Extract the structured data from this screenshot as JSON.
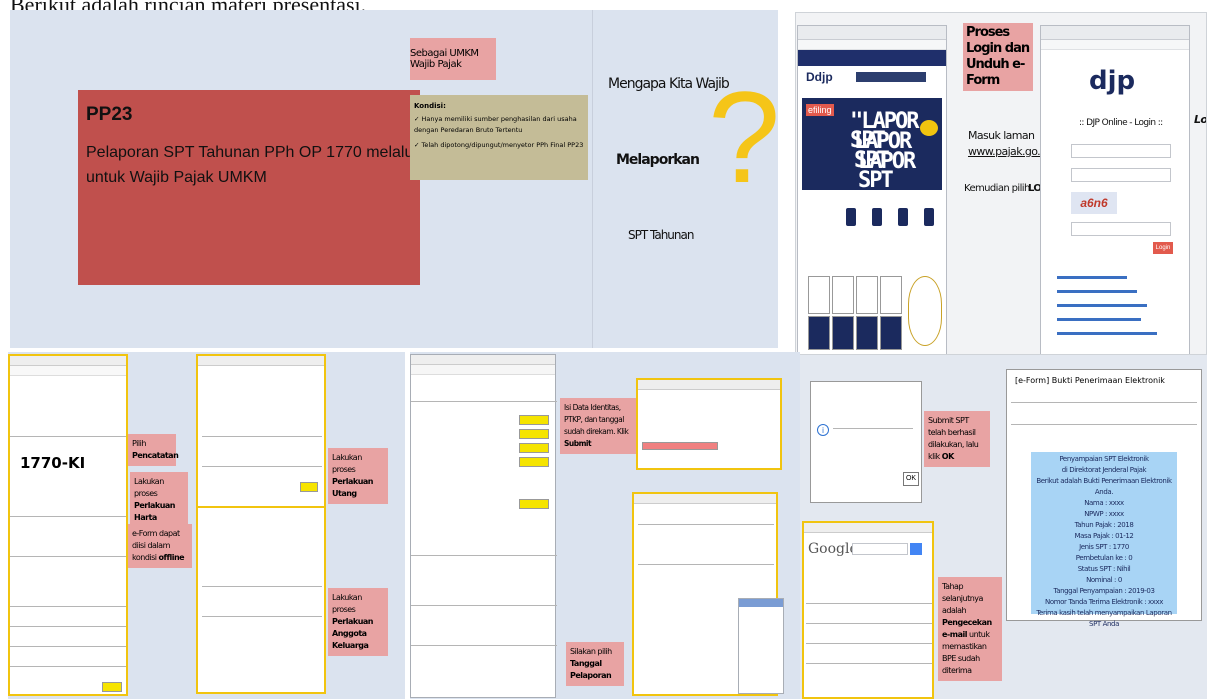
{
  "intro": "Berikut adalah rincian materi presentasi.",
  "panel1": {
    "title": "PP23",
    "subtitle": "Pelaporan SPT Tahunan PPh OP 1770 melalui e-Form untuk Wajib Pajak UMKM",
    "umkm_tag": "Sebagai UMKM Wajib Pajak",
    "kondisi_title": "Kondisi:",
    "kondisi_1": "✓ Hanya memiliki sumber penghasilan dari usaha dengan Peredaran Bruto Tertentu",
    "kondisi_2": "✓ Telah dipotong/dipungut/menyetor PPh Final PP23",
    "wajib_1": "Mengapa Kita Wajib",
    "wajib_2": "Melaporkan",
    "wajib_3": "SPT Tahunan",
    "qmark": "?",
    "accent_color": "#c0504d"
  },
  "panel2": {
    "tag": "Proses Login dan Unduh e-Form",
    "masuk": "Masuk laman",
    "url": "www.pajak.go.id",
    "kemudian": "Kemudian pilih",
    "login": "LOGIN",
    "lapor1": "\"LAPOR SPT",
    "lapor2": "LAPOR SPT",
    "lapor3": "LAPOR SPT",
    "djp_logo": "djp",
    "djp_online": ":: DJP Online - Login ::",
    "captcha": "a6n6",
    "login_btn": "Login",
    "right_cut": "Lo"
  },
  "panel3": {
    "form_no": "1770-KI",
    "note_pencatatan_a": "Pilih ",
    "note_pencatatan_b": "Pencatatan",
    "note_harta_a": "Lakukan proses ",
    "note_harta_b": "Perlakuan Harta",
    "note_offline_a": "e-Form dapat diisi dalam kondisi ",
    "note_offline_b": "offline",
    "note_utang_a": "Lakukan proses ",
    "note_utang_b": "Perlakuan Utang",
    "note_keluarga_a": "Lakukan proses ",
    "note_keluarga_b": "Perlakuan Anggota Keluarga"
  },
  "panel4": {
    "note_identitas_a": "Isi Data Identitas, PTKP, dan tanggal sudah direkam. Klik ",
    "note_identitas_b": "Submit",
    "note_tanggal_a": "Silakan pilih ",
    "note_tanggal_b": "Tanggal Pelaporan"
  },
  "panel5": {
    "note_submit_a": "Submit SPT telah berhasil dilakukan, lalu klik ",
    "note_submit_b": "OK",
    "ok_btn": "OK",
    "bpe_title": "[e-Form] Bukti Penerimaan Elektronik",
    "note_email_a": "Tahap selanjutnya adalah ",
    "note_email_b": "Pengecekan e-mail",
    "note_email_c": " untuk memastikan BPE sudah diterima",
    "google": "Google",
    "bpe_lines": [
      "Penyampaian SPT Elektronik",
      "di Direktorat Jenderal Pajak",
      "Berikut adalah Bukti Penerimaan Elektronik Anda.",
      "Nama : xxxx",
      "NPWP : xxxx",
      "Tahun Pajak : 2018",
      "Masa Pajak : 01-12",
      "Jenis SPT : 1770",
      "Pembetulan ke : 0",
      "Status SPT : Nihil",
      "Nominal : 0",
      "Tanggal Penyampaian : 2019-03",
      "Nomor Tanda Terima Elektronik : xxxx",
      "Terima kasih telah menyampaikan Laporan SPT Anda"
    ]
  }
}
